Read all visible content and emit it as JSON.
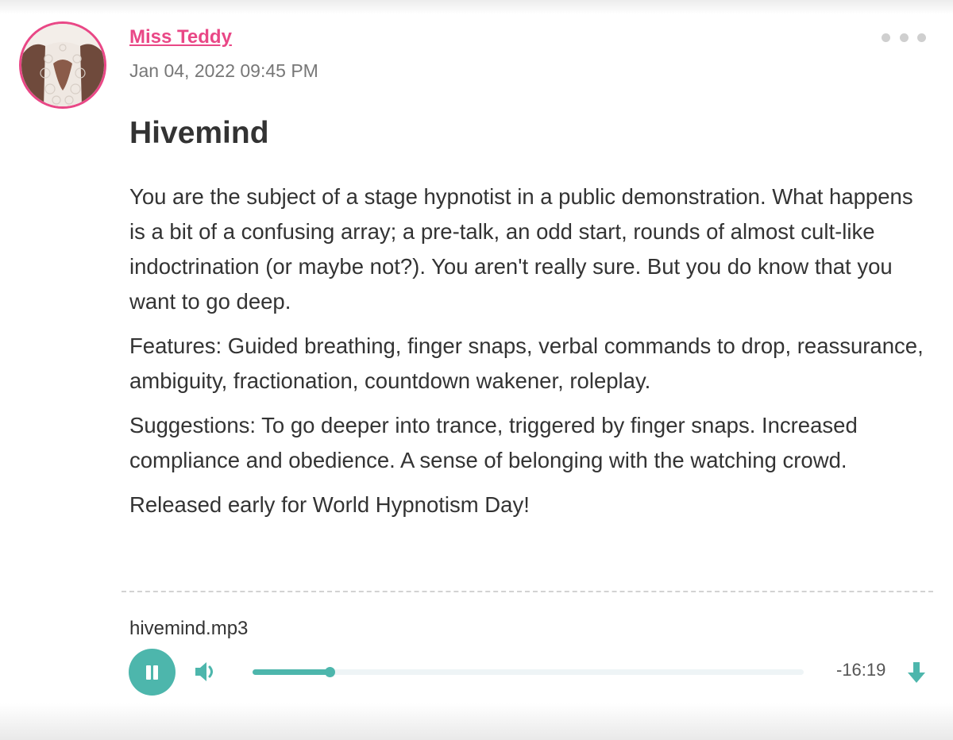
{
  "post": {
    "author": "Miss Teddy",
    "date": "Jan 04, 2022 09:45 PM",
    "title": "Hivemind",
    "paragraphs": [
      "You are the subject of a stage hypnotist in a public demonstration. What happens is a bit of a confusing array; a pre-talk, an odd start, rounds of almost cult-like indoctrination (or maybe not?). You aren't really sure. But you do know that you want to go deep.",
      "Features: Guided breathing, finger snaps, verbal commands to drop, reassurance, ambiguity, fractionation, countdown wakener, roleplay.",
      "Suggestions: To go deeper into trance, triggered by finger snaps. Increased compliance and obedience. A sense of belonging with the watching crowd.",
      "Released early for World Hypnotism Day!"
    ]
  },
  "audio": {
    "file_name": "hivemind.mp3",
    "time_remaining": "-16:19",
    "progress": 0.14,
    "state": "playing"
  },
  "icons": {
    "menu": "more-horizontal-icon",
    "play_state": "pause-icon",
    "volume": "volume-icon",
    "download": "download-icon"
  },
  "colors": {
    "accent": "#4db6ac",
    "author_link": "#e94786",
    "text": "#333333",
    "muted": "#777777"
  }
}
